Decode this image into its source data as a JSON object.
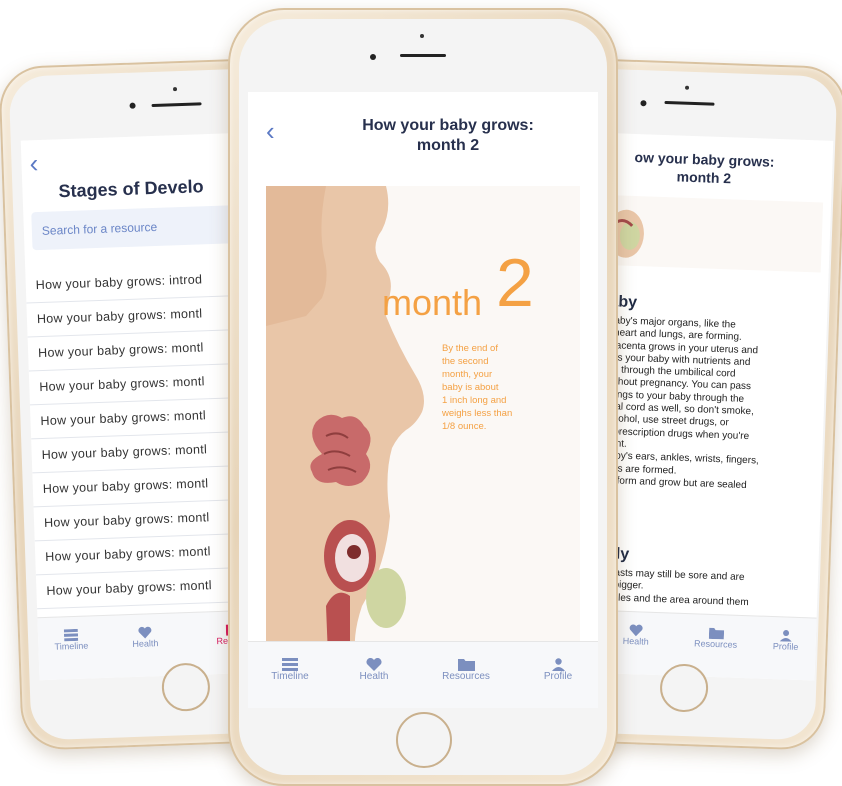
{
  "left": {
    "title": "Stages of Develo",
    "search_placeholder": "Search for a resource",
    "items": [
      "How your baby grows: introd",
      "How your baby grows: montl",
      "How your baby grows: montl",
      "How your baby grows: montl",
      "How your baby grows: montl",
      "How your baby grows: montl",
      "How your baby grows: montl",
      "How your baby grows: montl",
      "How your baby grows: montl",
      "How your baby grows: montl"
    ],
    "tabs": [
      "Timeline",
      "Health",
      "Resourc"
    ]
  },
  "center": {
    "title_line1": "How your baby grows:",
    "title_line2": "month 2",
    "month_word": "month",
    "month_num": "2",
    "desc": [
      "By the end of",
      "the second",
      "month, your",
      "baby is about",
      "1 inch long and",
      "weighs less than",
      "1/8 ounce."
    ],
    "tabs": [
      "Timeline",
      "Health",
      "Resources",
      "Profile"
    ]
  },
  "right": {
    "title_line1": "ow your baby grows:",
    "title_line2": "month 2",
    "heading_baby": "aby",
    "baby_lines": [
      "baby's major organs, like the",
      ", heart and lungs, are forming.",
      "placenta grows in your uterus and",
      "lies your baby with nutrients and",
      "en through the umbilical cord",
      "ughout pregnancy. You can pass",
      "things to your baby through the",
      "lical cord as well, so don't smoke,",
      "alcohol, use street drugs, or",
      "e prescription drugs when you're",
      "nant.",
      "baby's ears, ankles, wrists, fingers,",
      "toes are formed.",
      "ds form and grow but are sealed"
    ],
    "heading_body": "ody",
    "body_lines": [
      "breasts may still be sore and are",
      "ng bigger.",
      "nipples and the area around them"
    ],
    "tabs": [
      "Health",
      "Resources",
      "Profile"
    ]
  },
  "colors": {
    "accent": "#5b79c4",
    "active_tab": "#d6165c",
    "month": "#f4a144",
    "title": "#27304d"
  }
}
